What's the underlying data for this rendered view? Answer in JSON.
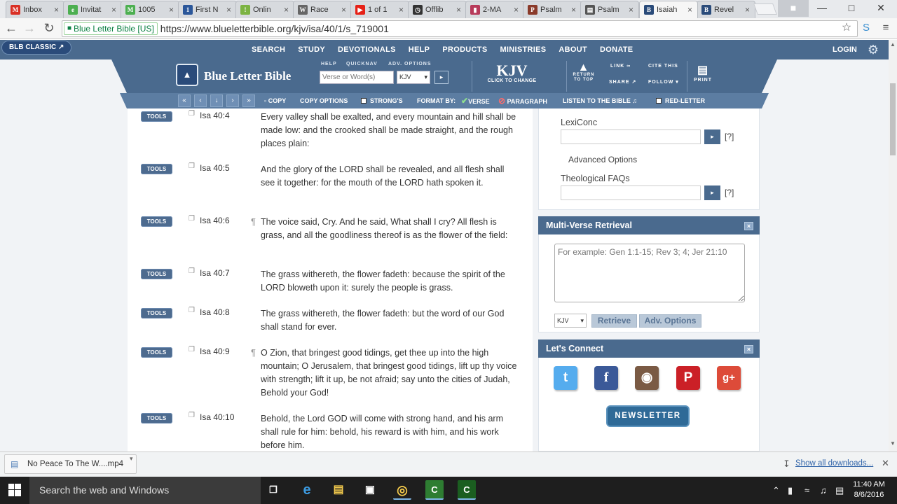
{
  "browser": {
    "tabs": [
      {
        "title": "Inbox",
        "icon": "gmail-icon",
        "fav": "M",
        "color": "#d93025"
      },
      {
        "title": "Invitat",
        "icon": "evite-icon",
        "fav": "e",
        "color": "#4caf50"
      },
      {
        "title": "1005",
        "icon": "map-icon",
        "fav": "M",
        "color": "#4caf50"
      },
      {
        "title": "First N",
        "icon": "doc-icon",
        "fav": "1",
        "color": "#2b579a"
      },
      {
        "title": "Onlin",
        "icon": "leaf-icon",
        "fav": "!",
        "color": "#7cb342"
      },
      {
        "title": "Race",
        "icon": "wikipedia-icon",
        "fav": "W",
        "color": "#666666"
      },
      {
        "title": "1 of 1",
        "icon": "youtube-icon",
        "fav": "▶",
        "color": "#e62117"
      },
      {
        "title": "Offlib",
        "icon": "clock-icon",
        "fav": "◷",
        "color": "#333333"
      },
      {
        "title": "2-MA",
        "icon": "bookmark-icon",
        "fav": "▮",
        "color": "#b73a5a"
      },
      {
        "title": "Psalm",
        "icon": "psalm-icon",
        "fav": "P",
        "color": "#8a3a2a"
      },
      {
        "title": "Psalm",
        "icon": "page-icon",
        "fav": "▤",
        "color": "#555555"
      },
      {
        "title": "Isaiah",
        "icon": "blb-icon",
        "fav": "B",
        "color": "#2a4b7a"
      },
      {
        "title": "Revel",
        "icon": "blb-icon",
        "fav": "B",
        "color": "#2a4b7a"
      }
    ],
    "secure_label": "Blue Letter Bible [US]",
    "url": "https://www.blueletterbible.org/kjv/isa/40/1/s_719001"
  },
  "site": {
    "blb_classic": "BLB CLASSIC",
    "nav": [
      "SEARCH",
      "STUDY",
      "DEVOTIONALS",
      "HELP",
      "PRODUCTS",
      "MINISTRIES",
      "ABOUT",
      "DONATE"
    ],
    "login": "LOGIN",
    "logo": "Blue Letter Bible",
    "help": "HELP",
    "quicknav": "QUICKNAV",
    "adv_options": "ADV. OPTIONS",
    "qn_placeholder": "Verse or Word(s)",
    "version": "KJV",
    "kjv_title": "KJV",
    "kjv_sub": "CLICK TO CHANGE",
    "return_top": "RETURN TO TOP",
    "link": "LINK",
    "share": "SHARE",
    "cite_this": "CITE THIS",
    "follow": "FOLLOW",
    "print": "PRINT",
    "toolbar": {
      "copy": "COPY",
      "copy_options": "COPY OPTIONS",
      "strongs": "STRONG'S",
      "format_by": "FORMAT BY:",
      "verse": "VERSE",
      "paragraph": "PARAGRAPH",
      "listen": "LISTEN TO THE BIBLE",
      "red_letter": "RED-LETTER"
    }
  },
  "verses": [
    {
      "tools": "TOOLS",
      "ref": "Isa 40:4",
      "pilcrow": "",
      "text": "Every valley shall be exalted, and every mountain and hill shall be made low: and the crooked shall be made straight, and the rough places plain:"
    },
    {
      "tools": "TOOLS",
      "ref": "Isa 40:5",
      "pilcrow": "",
      "text": "And the glory of the LORD shall be revealed, and all flesh shall see it together: for the mouth of the LORD hath spoken it."
    },
    {
      "tools": "TOOLS",
      "ref": "Isa 40:6",
      "pilcrow": "¶",
      "text": "The voice said, Cry. And he said, What shall I cry? All flesh is grass, and all the goodliness thereof is as the flower of the field:"
    },
    {
      "tools": "TOOLS",
      "ref": "Isa 40:7",
      "pilcrow": "",
      "text": "The grass withereth, the flower fadeth: because the spirit of the LORD bloweth upon it: surely the people is grass."
    },
    {
      "tools": "TOOLS",
      "ref": "Isa 40:8",
      "pilcrow": "",
      "text": "The grass withereth, the flower fadeth: but the word of our God shall stand for ever."
    },
    {
      "tools": "TOOLS",
      "ref": "Isa 40:9",
      "pilcrow": "¶",
      "text": "O Zion, that bringest good tidings, get thee up into the high mountain; O Jerusalem, that bringest good tidings, lift up thy voice with strength; lift it up, be not afraid; say unto the cities of Judah, Behold your God!"
    },
    {
      "tools": "TOOLS",
      "ref": "Isa 40:10",
      "pilcrow": "",
      "text": "Behold, the Lord GOD will come with strong hand, and his arm shall rule for him: behold, his reward is with him, and his work before him."
    }
  ],
  "sidebar": {
    "lexiconc": "LexiConc",
    "help_mark": "[?]",
    "advanced_options": "Advanced Options",
    "theological_faqs": "Theological FAQs",
    "multi_verse_title": "Multi-Verse Retrieval",
    "mv_placeholder": "For example: Gen 1:1-15; Rev 3; 4; Jer 21:10",
    "mv_version": "KJV",
    "retrieve": "Retrieve",
    "adv_options_btn": "Adv. Options",
    "lets_connect": "Let's Connect",
    "newsletter": "NEWSLETTER"
  },
  "downloads": {
    "file": "No Peace To The W....mp4",
    "show_all": "Show all downloads..."
  },
  "taskbar": {
    "search_placeholder": "Search the web and Windows",
    "time": "11:40 AM",
    "date": "8/6/2016"
  }
}
